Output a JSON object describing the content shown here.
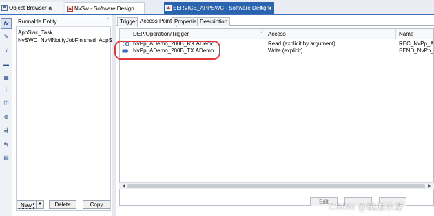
{
  "tabs": {
    "object_browser": "Object Browser",
    "object_browser_pin": "a",
    "nvsw": "NvSw - Software Design",
    "service": "SERVICE_APPSWC - Software Design",
    "service_pin": "-a",
    "close": "x"
  },
  "left": {
    "header": "Runnable Entity",
    "items": [
      "AppSwc_Task",
      "NvSWC_NvMNotifyJobFinished_AppSwc..."
    ],
    "new_button": "New",
    "delete_button": "Delete",
    "copy_button": "Copy"
  },
  "right": {
    "subtabs": [
      "Triggers",
      "Access Points",
      "Properties",
      "Description"
    ],
    "active_subtab": "Access Points",
    "columns": [
      "DEP/Operation/Trigger",
      "Access",
      "Name"
    ],
    "rows": [
      {
        "dep": "NvPp_ADemo_200B_RX.ADemo",
        "access": "Read (explicit by argument)",
        "name": "REC_NvPp_ADemo"
      },
      {
        "dep": "NvPp_ADemo_200B_TX.ADemo",
        "access": "Write (explicit)",
        "name": "SEND_NvPp_ADemo"
      }
    ],
    "edit_button": "Edit"
  },
  "watermark": "CSDN @桃源乐游",
  "colors": {
    "accent": "#2b64ae",
    "highlight": "#e0393c"
  }
}
